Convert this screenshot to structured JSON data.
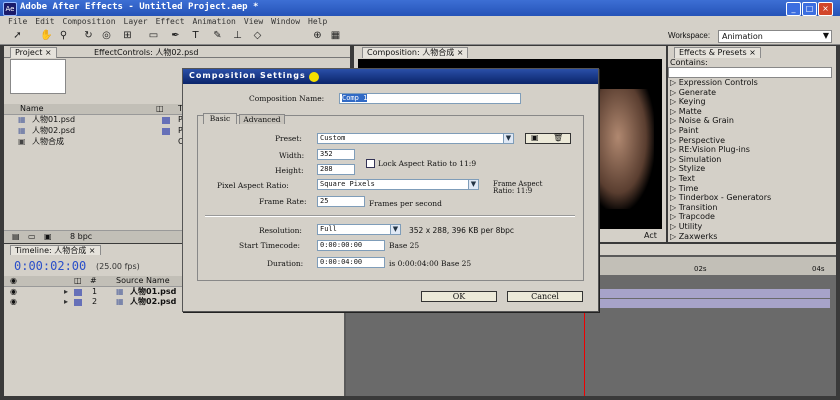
{
  "app": {
    "title": "Adobe After Effects - Untitled Project.aep *"
  },
  "menu": [
    "File",
    "Edit",
    "Composition",
    "Layer",
    "Effect",
    "Animation",
    "View",
    "Window",
    "Help"
  ],
  "workspace": {
    "label": "Workspace:",
    "value": "Animation"
  },
  "project": {
    "tab": "Project",
    "effect_tab": "EffectControls: 人物02.psd",
    "col_name": "Name",
    "col_t": "T",
    "items": [
      "人物01.psd",
      "人物02.psd",
      "人物合成"
    ],
    "item_types": [
      "P",
      "P",
      "C"
    ],
    "bpc": "8 bpc"
  },
  "comp": {
    "tab": "Composition: 人物合成",
    "act": "Act"
  },
  "effects": {
    "tab": "Effects & Presets",
    "contains": "Contains:",
    "items": [
      "Expression Controls",
      "Generate",
      "Keying",
      "Matte",
      "Noise & Grain",
      "Paint",
      "Perspective",
      "RE:Vision Plug-ins",
      "Simulation",
      "Stylize",
      "Text",
      "Time",
      "Tinderbox - Generators",
      "Transition",
      "Trapcode",
      "Utility",
      "Zaxwerks"
    ]
  },
  "timeline": {
    "tab": "Timeline: 人物合成",
    "timecode": "0:00:02:00",
    "fps": "(25.00 fps)",
    "source_name": "Source Name",
    "hash": "#",
    "layers": [
      {
        "num": "1",
        "name": "人物01.psd"
      },
      {
        "num": "2",
        "name": "人物02.psd"
      }
    ],
    "ruler": [
      "02s",
      "04s"
    ]
  },
  "dialog": {
    "title": "Composition Settings",
    "comp_name_label": "Composition Name:",
    "comp_name": "Comp 1",
    "tabs": [
      "Basic",
      "Advanced"
    ],
    "preset_label": "Preset:",
    "preset": "Custom",
    "width_label": "Width:",
    "width": "352",
    "height_label": "Height:",
    "height": "288",
    "lock_label": "Lock Aspect Ratio to 11:9",
    "par_label": "Pixel Aspect Ratio:",
    "par": "Square Pixels",
    "frame_aspect_label": "Frame Aspect",
    "frame_aspect_ratio": "Ratio: 11:9",
    "fr_label": "Frame Rate:",
    "fr": "25",
    "fr_unit": "Frames per second",
    "res_label": "Resolution:",
    "res": "Full",
    "res_info": "352 x 288, 396 KB per 8bpc",
    "start_label": "Start Timecode:",
    "start": "0:00:00:00",
    "start_base": "Base 25",
    "dur_label": "Duration:",
    "dur": "0:00:04:00",
    "dur_info": "is 0:00:04:00  Base 25",
    "ok": "OK",
    "cancel": "Cancel"
  }
}
